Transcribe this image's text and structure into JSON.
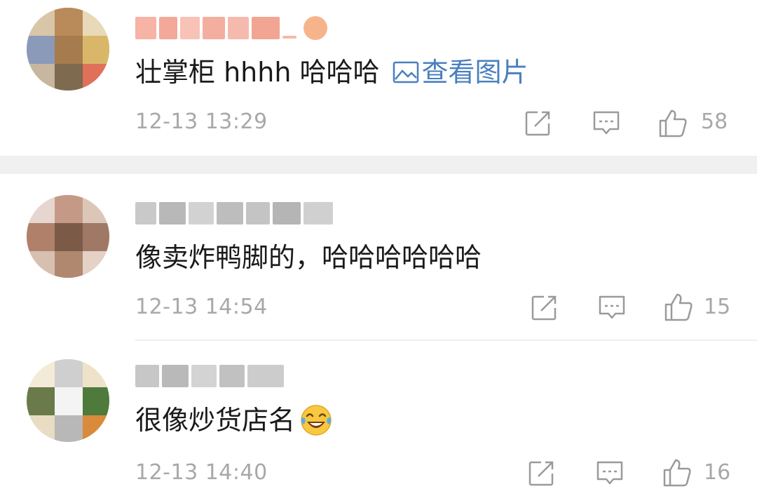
{
  "comments": [
    {
      "text": "壮掌柜 hhhh 哈哈哈",
      "view_image_label": "查看图片",
      "timestamp": "12-13 13:29",
      "like_count": "58",
      "avatar_icon": "avatar",
      "username_colors": [
        "#f6b3a6",
        "#f4a89a",
        "#f8c2b6",
        "#f3ae9f",
        "#f5baad",
        "#f2a593",
        "#f6b9a8"
      ]
    },
    {
      "text": "像卖炸鸭脚的，哈哈哈哈哈哈",
      "timestamp": "12-13 14:54",
      "like_count": "15",
      "avatar_icon": "avatar",
      "username_colors": [
        "#c9c9c9",
        "#b8b8b8",
        "#d2d2d2",
        "#bdbdbd",
        "#c4c4c4",
        "#b5b5b5",
        "#d0d0d0"
      ]
    },
    {
      "text": "很像炒货店名",
      "emoji": "laugh-cry-emoji",
      "timestamp": "12-13 14:40",
      "like_count": "16",
      "avatar_icon": "avatar",
      "username_colors": [
        "#c7c7c7",
        "#b9b9b9",
        "#d3d3d3",
        "#c1c1c1",
        "#cccccc"
      ]
    }
  ],
  "colors": {
    "text": "#1a1a1a",
    "muted": "#a8a8a8",
    "link": "#4a7fbf",
    "separator": "#f0f0f0"
  }
}
